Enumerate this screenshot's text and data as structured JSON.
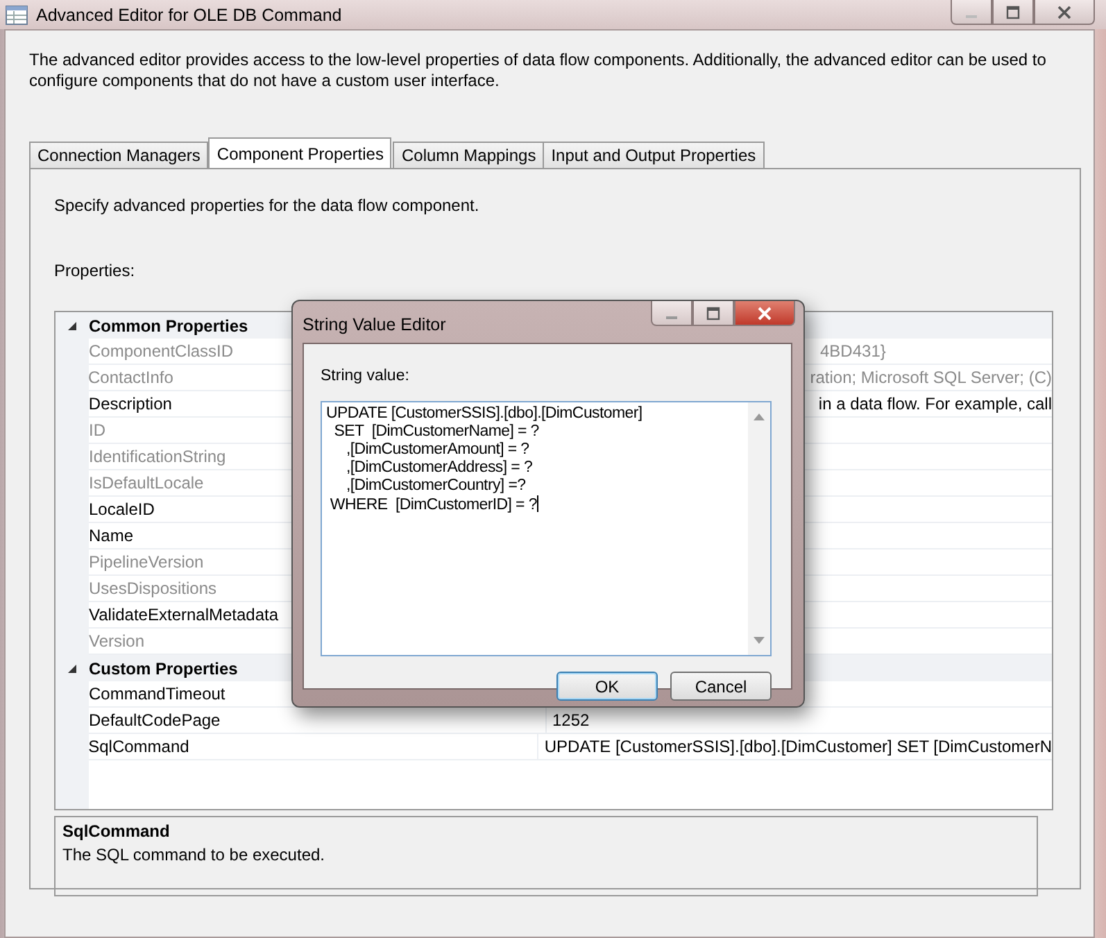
{
  "window": {
    "title": "Advanced Editor for OLE DB Command"
  },
  "intro": "The advanced editor provides access to the low-level properties of data flow components. Additionally, the advanced editor can be used to configure components that do not have a custom user interface.",
  "tabs": [
    {
      "label": "Connection Managers",
      "selected": false
    },
    {
      "label": "Component Properties",
      "selected": true
    },
    {
      "label": "Column Mappings",
      "selected": false
    },
    {
      "label": "Input and Output Properties",
      "selected": false
    }
  ],
  "panel": {
    "instruction": "Specify advanced properties for the data flow component.",
    "properties_label": "Properties:"
  },
  "property_grid": {
    "categories": [
      {
        "name": "Common Properties",
        "expanded": true,
        "properties": [
          {
            "name": "ComponentClassID",
            "disabled": true,
            "value": "4BD431}"
          },
          {
            "name": "ContactInfo",
            "disabled": true,
            "value": "ration; Microsoft SQL Server; (C)"
          },
          {
            "name": "Description",
            "disabled": false,
            "value": "in a data flow. For example, call"
          },
          {
            "name": "ID",
            "disabled": true
          },
          {
            "name": "IdentificationString",
            "disabled": true
          },
          {
            "name": "IsDefaultLocale",
            "disabled": true
          },
          {
            "name": "LocaleID",
            "disabled": false
          },
          {
            "name": "Name",
            "disabled": false
          },
          {
            "name": "PipelineVersion",
            "disabled": true
          },
          {
            "name": "UsesDispositions",
            "disabled": true
          },
          {
            "name": "ValidateExternalMetadata",
            "disabled": false
          },
          {
            "name": "Version",
            "disabled": true
          }
        ]
      },
      {
        "name": "Custom Properties",
        "expanded": true,
        "properties": [
          {
            "name": "CommandTimeout",
            "disabled": false
          },
          {
            "name": "DefaultCodePage",
            "disabled": false,
            "value": "1252"
          },
          {
            "name": "SqlCommand",
            "disabled": false,
            "value": "UPDATE [CustomerSSIS].[dbo].[DimCustomer]  SET  [DimCustomerN"
          }
        ]
      }
    ]
  },
  "description": {
    "title": "SqlCommand",
    "text": "The SQL command to be executed."
  },
  "dialog": {
    "title": "String Value Editor",
    "label": "String value:",
    "value": "UPDATE [CustomerSSIS].[dbo].[DimCustomer]\n  SET  [DimCustomerName] = ?\n     ,[DimCustomerAmount] = ?\n     ,[DimCustomerAddress] = ?\n     ,[DimCustomerCountry] =?\n WHERE  [DimCustomerID] = ?",
    "buttons": [
      {
        "label": "OK",
        "default": true
      },
      {
        "label": "Cancel",
        "default": false
      }
    ]
  }
}
